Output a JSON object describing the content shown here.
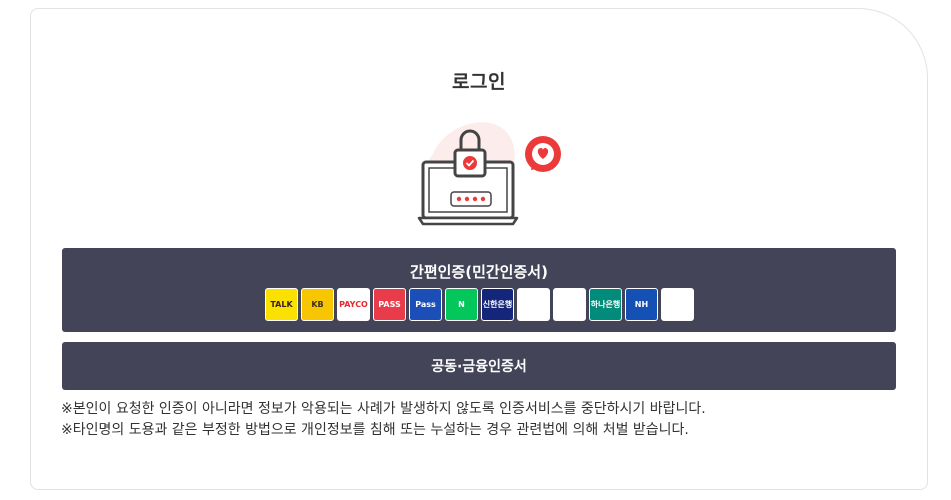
{
  "page": {
    "title": "로그인"
  },
  "simple_auth": {
    "label": "간편인증(민간인증서)",
    "providers": [
      {
        "name": "kakao-talk",
        "text": "TALK",
        "bg": "#fae100",
        "fg": "#3a1d1d"
      },
      {
        "name": "kb",
        "text": "KB",
        "bg": "#f7c600",
        "fg": "#3a3026"
      },
      {
        "name": "payco",
        "text": "PAYCO",
        "bg": "#ffffff",
        "fg": "#e8292e"
      },
      {
        "name": "pass",
        "text": "PASS",
        "bg": "#e83c4a",
        "fg": "#ffffff"
      },
      {
        "name": "samsung-pass",
        "text": "Pass",
        "bg": "#1b4fb7",
        "fg": "#ffffff"
      },
      {
        "name": "naver",
        "text": "N",
        "bg": "#03c75a",
        "fg": "#ffffff"
      },
      {
        "name": "shinhan",
        "text": "신한은행",
        "bg": "#13267a",
        "fg": "#ffffff"
      },
      {
        "name": "toss",
        "text": "",
        "bg": "#ffffff",
        "fg": "#0064ff"
      },
      {
        "name": "bank-salad",
        "text": "",
        "bg": "#ffffff",
        "fg": "#21b68c"
      },
      {
        "name": "hana",
        "text": "하나은행",
        "bg": "#008b7a",
        "fg": "#ffffff"
      },
      {
        "name": "nh",
        "text": "NH",
        "bg": "#1551b5",
        "fg": "#ffffff"
      },
      {
        "name": "shinhan-card",
        "text": "",
        "bg": "#ffffff",
        "fg": "#e60012"
      }
    ]
  },
  "cert_auth": {
    "label": "공동·금융인증서"
  },
  "notice": {
    "line1": "※본인이 요청한 인증이 아니라면 정보가 악용되는 사례가 발생하지 않도록 인증서비스를 중단하시기 바랍니다.",
    "line2": "※타인명의 도용과 같은 부정한 방법으로 개인정보를 침해 또는 누설하는 경우 관련법에 의해 처벌 받습니다."
  }
}
